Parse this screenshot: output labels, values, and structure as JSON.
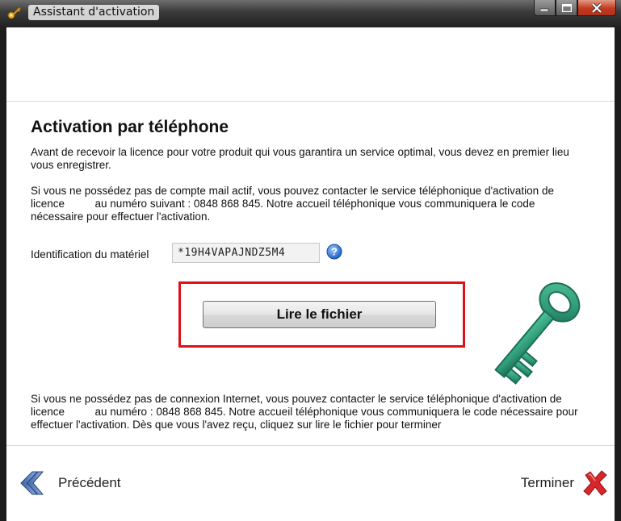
{
  "window": {
    "title": "Assistant d'activation"
  },
  "content": {
    "heading": "Activation par téléphone",
    "intro": "Avant de recevoir la licence pour votre produit qui vous garantira un service optimal, vous devez en premier lieu vous enregistrer.",
    "phone_info": "Si vous ne possédez pas de compte mail actif, vous pouvez contacter le service téléphonique d'activation de licence          au numéro suivant : 0848 868 845. Notre accueil téléphonique vous communiquera le code nécessaire pour effectuer l'activation.",
    "hardware_label": "Identification du matériel",
    "hardware_id": "*19H4VAPAJNDZ5M4",
    "read_file_button": "Lire le fichier",
    "no_internet_info": "Si vous ne possédez pas de connexion Internet, vous pouvez contacter le service téléphonique d'activation de licence          au numéro : 0848 868 845. Notre accueil téléphonique vous communiquera le code nécessaire pour effectuer l'activation. Dès que vous l'avez reçu, cliquez sur lire le fichier pour terminer"
  },
  "footer": {
    "back_label": "Précédent",
    "finish_label": "Terminer"
  },
  "icons": {
    "app": "key-icon",
    "help": "help-icon",
    "back": "double-chevron-left-icon",
    "finish": "red-x-icon",
    "decoration": "green-key-illustration"
  },
  "colors": {
    "highlight_border": "#e0101a",
    "key_green": "#2f9a78",
    "back_arrow_blue": "#3a5fa0",
    "finish_x_red": "#d9262a"
  }
}
